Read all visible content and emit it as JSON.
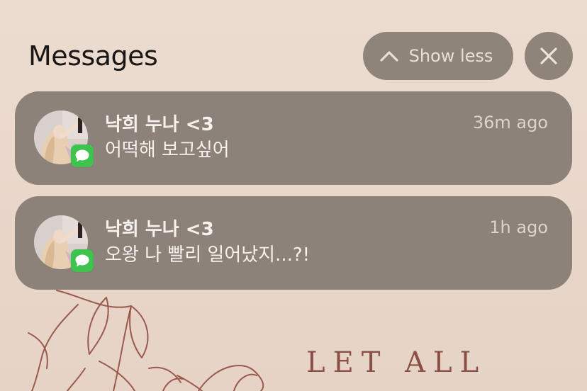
{
  "header": {
    "title": "Messages",
    "show_less_label": "Show less",
    "show_less_icon": "chevron-up-icon",
    "close_icon": "close-icon"
  },
  "notifications": [
    {
      "sender": "낙희 누나 <3",
      "time": "36m ago",
      "message": "어떡해 보고싶어",
      "app_icon": "messages-app-icon"
    },
    {
      "sender": "낙희 누나 <3",
      "time": "1h ago",
      "message": "오왕 나 빨리 일어났지...?!",
      "app_icon": "messages-app-icon"
    }
  ],
  "wallpaper": {
    "text": "LET ALL",
    "text_color": "#8a4f45"
  },
  "colors": {
    "background": "#ead9cd",
    "notification_bg": "#8d8279",
    "button_bg": "#8f847a",
    "badge_green": "#3fc34f"
  }
}
